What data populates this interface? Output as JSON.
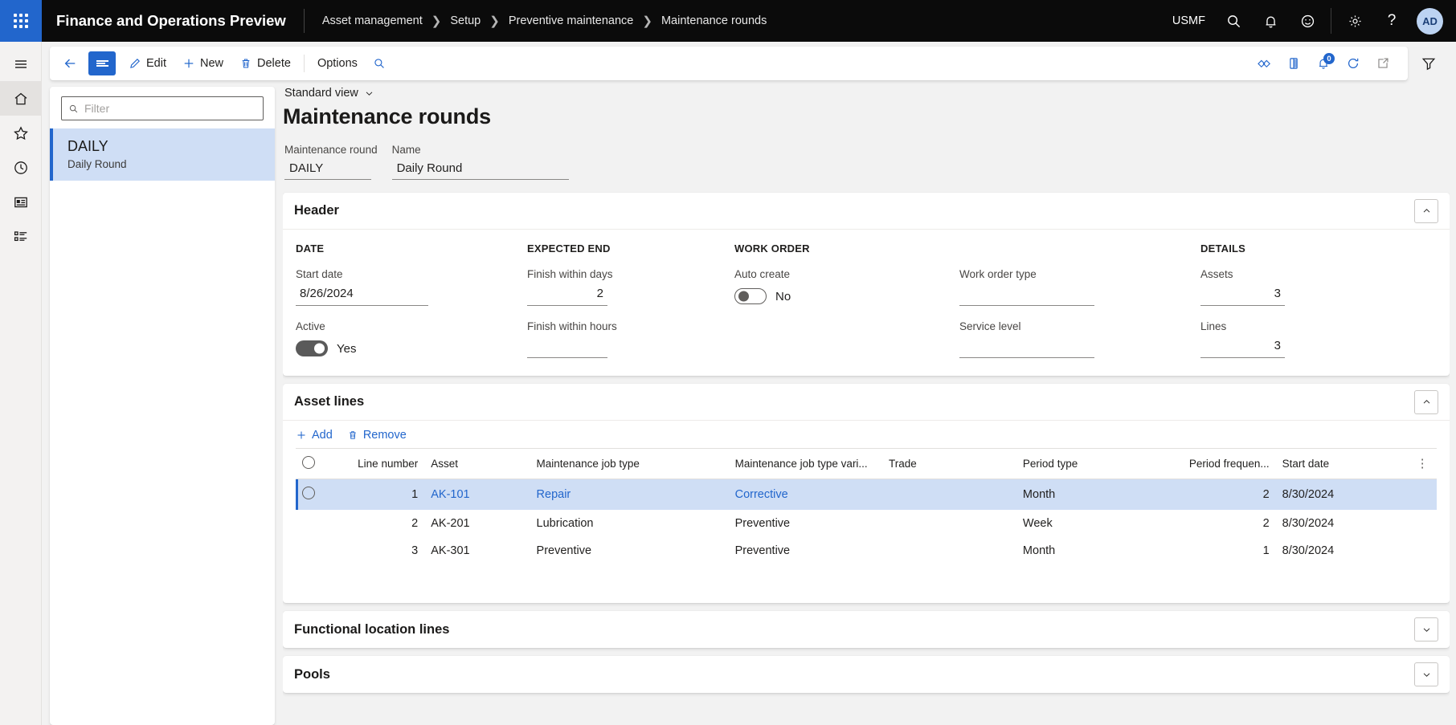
{
  "topnav": {
    "app_title": "Finance and Operations Preview",
    "waffle_icon": "app-launcher-icon",
    "breadcrumb": [
      "Asset management",
      "Setup",
      "Preventive maintenance",
      "Maintenance rounds"
    ],
    "company": "USMF",
    "icons": [
      "search-icon",
      "bell-icon",
      "feedback-smiley-icon",
      "gear-icon",
      "help-question-icon"
    ],
    "avatar_initials": "AD"
  },
  "rail": {
    "items": [
      {
        "name": "hamburger-menu-icon"
      },
      {
        "name": "home-icon"
      },
      {
        "name": "favorites-star-icon"
      },
      {
        "name": "recent-clock-icon"
      },
      {
        "name": "workspaces-icon"
      },
      {
        "name": "modules-list-icon"
      }
    ]
  },
  "commandbar": {
    "back_icon": "back-arrow-icon",
    "show_list_icon": "show-list-icon",
    "edit_label": "Edit",
    "new_label": "New",
    "delete_label": "Delete",
    "options_label": "Options",
    "search_icon": "search-icon",
    "right_icons": [
      {
        "name": "personalize-icon"
      },
      {
        "name": "attachments-icon"
      },
      {
        "name": "notifications-icon",
        "badge": "0"
      },
      {
        "name": "refresh-icon"
      },
      {
        "name": "open-in-new-window-icon"
      }
    ],
    "filter_pane_icon": "filter-funnel-icon"
  },
  "listpane": {
    "filter_placeholder": "Filter",
    "filter_value": "",
    "search_icon": "search-icon",
    "items": [
      {
        "title": "DAILY",
        "subtitle": "Daily Round",
        "selected": true
      }
    ]
  },
  "page": {
    "view_label": "Standard view",
    "view_chevron_icon": "chevron-down-icon",
    "title": "Maintenance rounds",
    "fields": [
      {
        "label": "Maintenance round",
        "value": "DAILY"
      },
      {
        "label": "Name",
        "value": "Daily Round"
      }
    ]
  },
  "header_section": {
    "title": "Header",
    "collapse_icon": "chevron-up-icon",
    "columns": [
      {
        "group": "DATE",
        "fields": [
          {
            "label": "Start date",
            "value": "8/26/2024",
            "type": "text"
          },
          {
            "label": "Active",
            "value": "Yes",
            "type": "toggle",
            "state": "on"
          }
        ]
      },
      {
        "group": "EXPECTED END",
        "fields": [
          {
            "label": "Finish within days",
            "value": "2",
            "type": "number"
          },
          {
            "label": "Finish within hours",
            "value": "",
            "type": "number"
          }
        ]
      },
      {
        "group": "WORK ORDER",
        "fields": [
          {
            "label": "Auto create",
            "value": "No",
            "type": "toggle",
            "state": "off"
          }
        ]
      },
      {
        "group": "",
        "fields": [
          {
            "label": "Work order type",
            "value": "",
            "type": "text"
          },
          {
            "label": "Service level",
            "value": "",
            "type": "text"
          }
        ]
      },
      {
        "group": "DETAILS",
        "fields": [
          {
            "label": "Assets",
            "value": "3",
            "type": "number"
          },
          {
            "label": "Lines",
            "value": "3",
            "type": "number"
          }
        ]
      }
    ]
  },
  "asset_lines": {
    "title": "Asset lines",
    "collapse_icon": "chevron-up-icon",
    "add_label": "Add",
    "add_icon": "plus-icon",
    "remove_label": "Remove",
    "remove_icon": "trash-icon",
    "more_icon": "grid-options-icon",
    "columns": [
      "Line number",
      "Asset",
      "Maintenance job type",
      "Maintenance job type vari...",
      "Trade",
      "Period type",
      "Period frequen...",
      "Start date"
    ],
    "rows": [
      {
        "selected": true,
        "line_number": "1",
        "asset": "AK-101",
        "job_type": "Repair",
        "job_type_variant": "Corrective",
        "trade": "",
        "period_type": "Month",
        "period_frequency": "2",
        "start_date": "8/30/2024"
      },
      {
        "selected": false,
        "line_number": "2",
        "asset": "AK-201",
        "job_type": "Lubrication",
        "job_type_variant": "Preventive",
        "trade": "",
        "period_type": "Week",
        "period_frequency": "2",
        "start_date": "8/30/2024"
      },
      {
        "selected": false,
        "line_number": "3",
        "asset": "AK-301",
        "job_type": "Preventive",
        "job_type_variant": "Preventive",
        "trade": "",
        "period_type": "Month",
        "period_frequency": "1",
        "start_date": "8/30/2024"
      }
    ]
  },
  "collapsed_sections": [
    {
      "title": "Functional location lines",
      "expand_icon": "chevron-down-icon"
    },
    {
      "title": "Pools",
      "expand_icon": "chevron-down-icon"
    }
  ],
  "colors": {
    "accent": "#2266cc",
    "topbar": "#0b0b0b",
    "selection": "#cfdef5",
    "page_bg": "#f2f2f2"
  }
}
